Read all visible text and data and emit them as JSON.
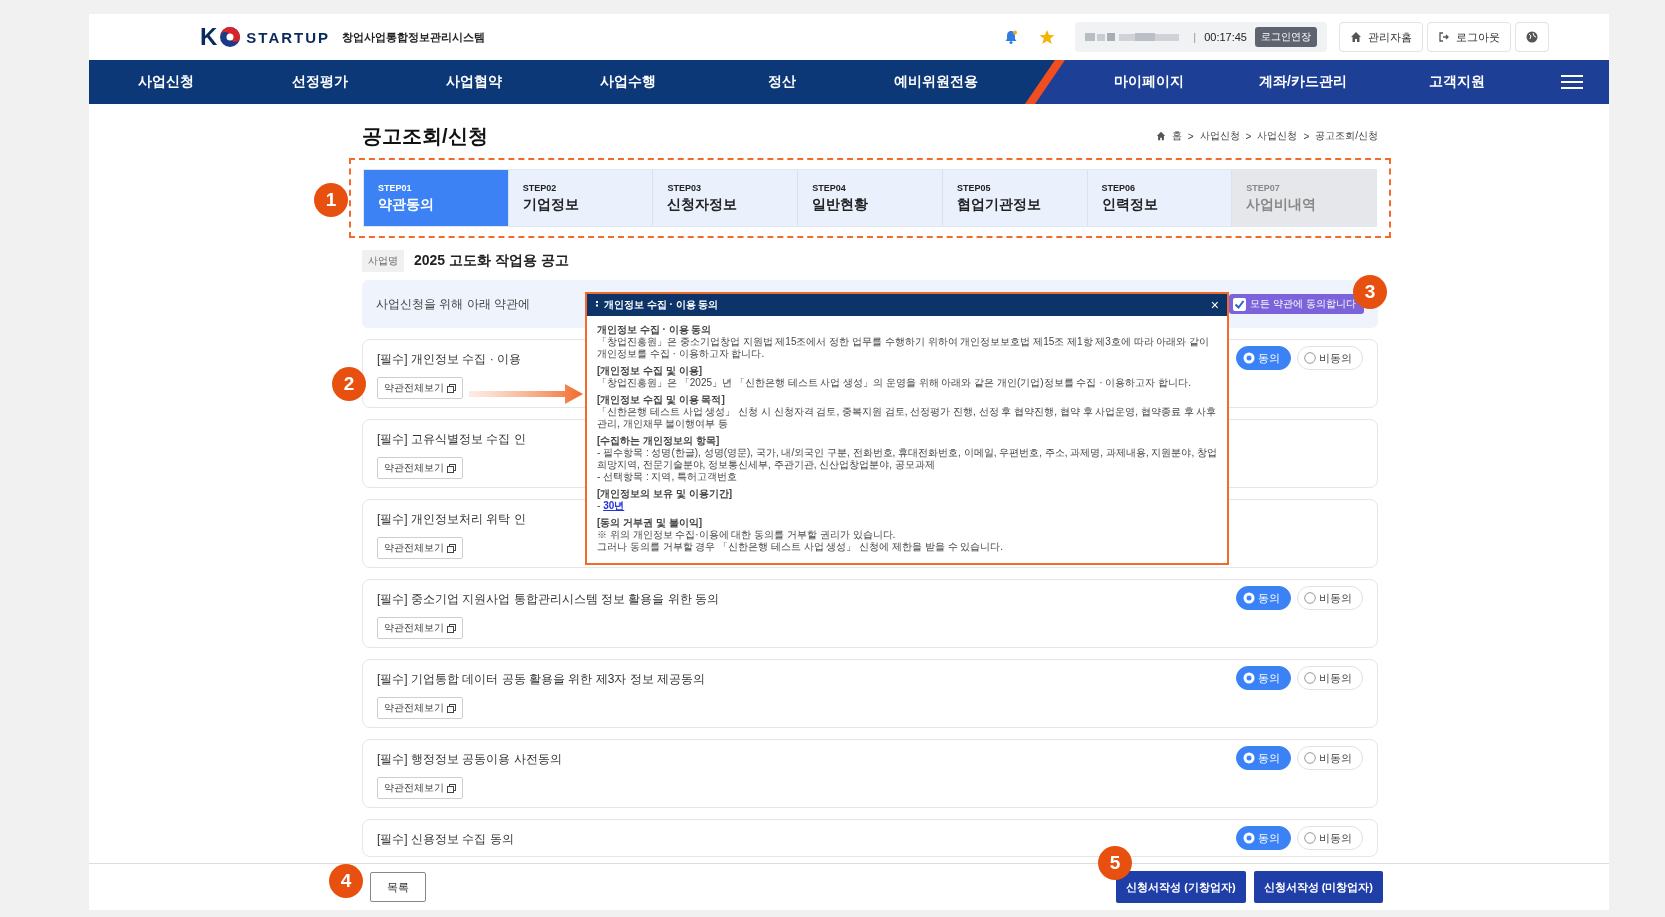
{
  "header": {
    "logo_left": "K",
    "logo_right": "STARTUP",
    "system_name": "창업사업통합정보관리시스템",
    "session_separator": "|",
    "session_time": "00:17:45",
    "extend_button": "로그인연장",
    "links": [
      {
        "kind": "home",
        "label": "관리자홈"
      },
      {
        "kind": "logout",
        "label": "로그아웃"
      }
    ]
  },
  "nav": {
    "left": [
      "사업신청",
      "선정평가",
      "사업협약",
      "사업수행",
      "정산",
      "예비위원전용"
    ],
    "right": [
      "마이페이지",
      "계좌/카드관리",
      "고객지원"
    ]
  },
  "page_title": "공고조회/신청",
  "breadcrumb": {
    "separator": ">",
    "items": [
      "홈",
      "사업신청",
      "사업신청",
      "공고조회/신청"
    ]
  },
  "steps": [
    {
      "step": "STEP01",
      "label": "약관동의",
      "selected": true,
      "disabled": false
    },
    {
      "step": "STEP02",
      "label": "기업정보",
      "selected": false,
      "disabled": false
    },
    {
      "step": "STEP03",
      "label": "신청자정보",
      "selected": false,
      "disabled": false
    },
    {
      "step": "STEP04",
      "label": "일반현황",
      "selected": false,
      "disabled": false
    },
    {
      "step": "STEP05",
      "label": "협업기관정보",
      "selected": false,
      "disabled": false
    },
    {
      "step": "STEP06",
      "label": "인력정보",
      "selected": false,
      "disabled": false
    },
    {
      "step": "STEP07",
      "label": "사업비내역",
      "selected": false,
      "disabled": true
    }
  ],
  "business": {
    "label": "사업명",
    "name": "2025 고도화 작업용 공고"
  },
  "notice": {
    "text": "사업신청을 위해 아래 약관에",
    "agree_all": {
      "label": "모든 약관에 동의합니다",
      "checked": true
    }
  },
  "terms": [
    {
      "title": "[필수] 개인정보 수집 · 이용",
      "view_button": "약관전체보기",
      "options": [
        {
          "label": "동의",
          "selected": true
        },
        {
          "label": "비동의",
          "selected": false
        }
      ]
    },
    {
      "title": "[필수] 고유식별정보 수집 인",
      "view_button": "약관전체보기"
    },
    {
      "title": "[필수] 개인정보처리 위탁 인",
      "view_button": "약관전체보기"
    },
    {
      "title": "[필수] 중소기업 지원사업 통합관리시스템 정보 활용을 위한 동의",
      "view_button": "약관전체보기",
      "options": [
        {
          "label": "동의",
          "selected": true
        },
        {
          "label": "비동의",
          "selected": false
        }
      ]
    },
    {
      "title": "[필수] 기업통합 데이터 공동 활용을 위한 제3자 정보 제공동의",
      "view_button": "약관전체보기",
      "options": [
        {
          "label": "동의",
          "selected": true
        },
        {
          "label": "비동의",
          "selected": false
        }
      ]
    },
    {
      "title": "[필수] 행정정보 공동이용 사전동의",
      "view_button": "약관전체보기",
      "options": [
        {
          "label": "동의",
          "selected": true
        },
        {
          "label": "비동의",
          "selected": false
        }
      ]
    },
    {
      "title": "[필수] 신용정보 수집 동의",
      "options": [
        {
          "label": "동의",
          "selected": true
        },
        {
          "label": "비동의",
          "selected": false
        }
      ]
    }
  ],
  "popup": {
    "title": "개인정보 수집 · 이용 동의",
    "close": "×",
    "body": [
      {
        "kind": "heading",
        "text": "개인정보 수집 · 이용 동의"
      },
      {
        "kind": "text",
        "text": "「창업진흥원」은 중소기업창업 지원법 제15조에서 정한 업무를 수행하기 위하여 개인정보보호법 제15조 제1항 제3호에 따라 아래와 같이 개인정보를 수집 · 이용하고자 합니다."
      },
      {
        "kind": "heading",
        "text": "[개인정보 수집 및 이용]"
      },
      {
        "kind": "text",
        "text": "「창업진흥원」은 「2025」년 「신한은행 테스트 사업 생성」의 운영을 위해 아래와 같은 개인(기업)정보를 수집 · 이용하고자 합니다."
      },
      {
        "kind": "heading",
        "text": "[개인정보 수집 및 이용 목적]"
      },
      {
        "kind": "text",
        "text": "「신한은행 테스트 사업 생성」 신청 시 신청자격 검토, 중복지원 검토, 선정평가 진행, 선정 후 협약진행, 협약 후 사업운영, 협약종료 후 사후관리, 개인채무 불이행여부 등"
      },
      {
        "kind": "heading",
        "text": "[수집하는 개인정보의 항목]"
      },
      {
        "kind": "text",
        "text": "- 필수항목 : 성명(한글), 성명(영문), 국가, 내/외국인 구분, 전화번호, 휴대전화번호, 이메일, 우편번호, 주소, 과제명, 과제내용, 지원분야, 창업희망지역, 전문기술분야, 정보통신세부, 주관기관, 신산업창업분야, 공모과제"
      },
      {
        "kind": "text",
        "text": "- 선택항목 : 지역, 특허고객번호"
      },
      {
        "kind": "heading",
        "text": "[개인정보의 보유 및 이용기간]"
      },
      {
        "kind": "link",
        "prefix": "-",
        "link": "30년"
      },
      {
        "kind": "heading",
        "text": "[동의 거부권 및 불이익]"
      },
      {
        "kind": "text",
        "text": "※ 위의 개인정보 수집·이용에 대한 동의를 거부할 권리가 있습니다."
      },
      {
        "kind": "text",
        "text": "그러나 동의를 거부할 경우 「신한은행 테스트 사업 생성」 신청에 제한을 받을 수 있습니다."
      }
    ]
  },
  "footer": {
    "list_button": "목록",
    "actions": [
      "신청서작성 (기창업자)",
      "신청서작성 (미창업자)"
    ]
  },
  "annotations": [
    "1",
    "2",
    "3",
    "4",
    "5"
  ]
}
